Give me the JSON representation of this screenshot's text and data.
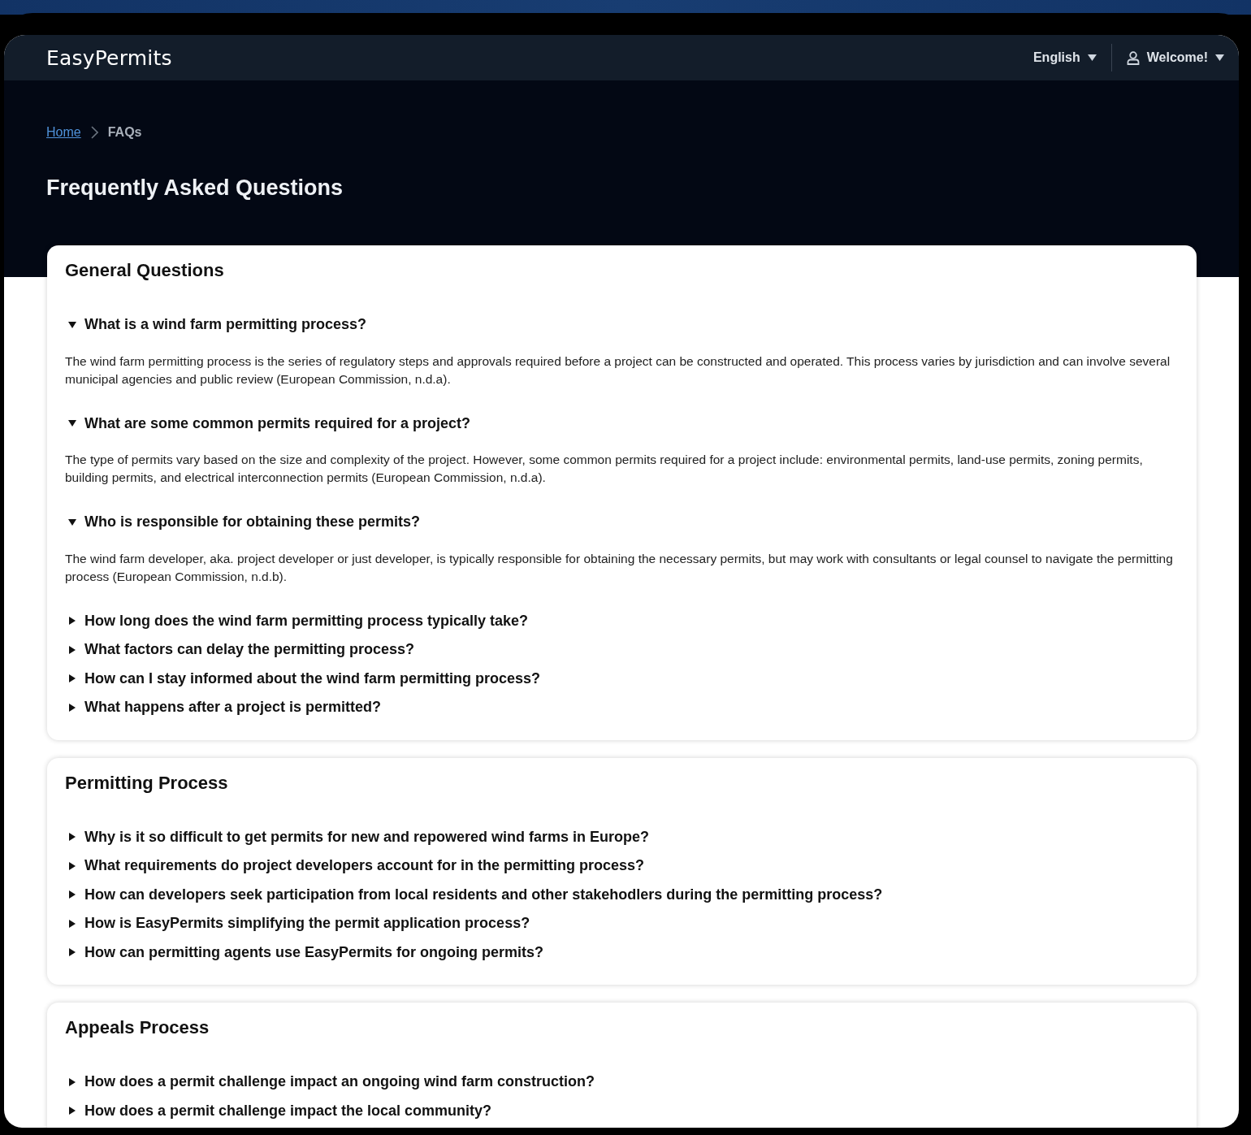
{
  "header": {
    "logo": "EasyPermits",
    "language": "English",
    "user": "Welcome!"
  },
  "breadcrumb": [
    {
      "label": "Home",
      "link": true
    },
    {
      "label": "FAQs",
      "link": false
    }
  ],
  "page_title": "Frequently Asked Questions",
  "sections": [
    {
      "title": "General Questions",
      "items": [
        {
          "question": "What is a wind farm permitting process?",
          "expanded": true,
          "answer": "The wind farm permitting process is the series of regulatory steps and approvals required before a project can be constructed and operated. This process varies by jurisdiction and can involve several municipal agencies and public review (European Commission, n.d.a)."
        },
        {
          "question": "What are some common permits required for a project?",
          "expanded": true,
          "answer": "The type of permits vary based on the size and complexity of the project. However, some common permits required for a project include: environmental permits, land-use permits, zoning permits, building permits, and electrical interconnection permits (European Commission, n.d.a)."
        },
        {
          "question": "Who is responsible for obtaining these permits?",
          "expanded": true,
          "answer": "The wind farm developer, aka. project developer or just developer, is typically responsible for obtaining the necessary permits, but may work with consultants or legal counsel to navigate the permitting process (European Commission, n.d.b)."
        },
        {
          "question": "How long does the wind farm permitting process typically take?",
          "expanded": false
        },
        {
          "question": "What factors can delay the permitting process?",
          "expanded": false
        },
        {
          "question": "How can I stay informed about the wind farm permitting process?",
          "expanded": false
        },
        {
          "question": "What happens after a project is permitted?",
          "expanded": false
        }
      ]
    },
    {
      "title": "Permitting Process",
      "items": [
        {
          "question": "Why is it so difficult to get permits for new and repowered wind farms in Europe?",
          "expanded": false
        },
        {
          "question": "What requirements do project developers account for in the permitting process?",
          "expanded": false
        },
        {
          "question": "How can developers seek participation from local residents and other stakehodlers during the permitting process?",
          "expanded": false
        },
        {
          "question": "How is EasyPermits simplifying the permit application process?",
          "expanded": false
        },
        {
          "question": "How can permitting agents use EasyPermits for ongoing permits?",
          "expanded": false
        }
      ]
    },
    {
      "title": "Appeals Process",
      "items": [
        {
          "question": "How does a permit challenge impact an ongoing wind farm construction?",
          "expanded": false
        },
        {
          "question": "How does a permit challenge impact the local community?",
          "expanded": false
        }
      ]
    }
  ]
}
